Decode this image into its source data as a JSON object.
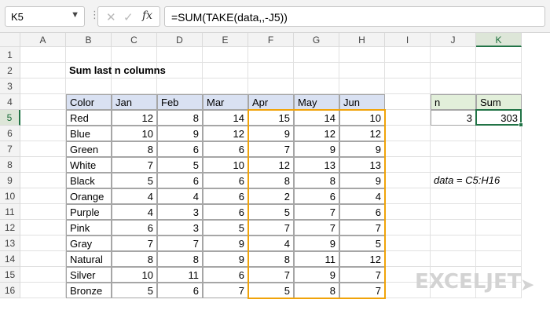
{
  "formula_bar": {
    "name_box": "K5",
    "formula": "=SUM(TAKE(data,,-J5))",
    "fx_label": "fx"
  },
  "columns": [
    "A",
    "B",
    "C",
    "D",
    "E",
    "F",
    "G",
    "H",
    "I",
    "J",
    "K"
  ],
  "rows": [
    "1",
    "2",
    "3",
    "4",
    "5",
    "6",
    "7",
    "8",
    "9",
    "10",
    "11",
    "12",
    "13",
    "14",
    "15",
    "16"
  ],
  "selected_column": "K",
  "selected_row": "5",
  "sheet": {
    "title": "Sum last n columns",
    "headers": [
      "Color",
      "Jan",
      "Feb",
      "Mar",
      "Apr",
      "May",
      "Jun"
    ],
    "data": [
      [
        "Red",
        12,
        8,
        14,
        15,
        14,
        10
      ],
      [
        "Blue",
        10,
        9,
        12,
        9,
        12,
        12
      ],
      [
        "Green",
        8,
        6,
        6,
        7,
        9,
        9
      ],
      [
        "White",
        7,
        5,
        10,
        12,
        13,
        13
      ],
      [
        "Black",
        5,
        6,
        6,
        8,
        8,
        9
      ],
      [
        "Orange",
        4,
        4,
        6,
        2,
        6,
        4
      ],
      [
        "Purple",
        4,
        3,
        6,
        5,
        7,
        6
      ],
      [
        "Pink",
        6,
        3,
        5,
        7,
        7,
        7
      ],
      [
        "Gray",
        7,
        7,
        9,
        4,
        9,
        5
      ],
      [
        "Natural",
        8,
        8,
        9,
        8,
        11,
        12
      ],
      [
        "Silver",
        10,
        11,
        6,
        7,
        9,
        7
      ],
      [
        "Bronze",
        5,
        6,
        7,
        5,
        8,
        7
      ]
    ],
    "input_headers": [
      "n",
      "Sum"
    ],
    "input_values": [
      3,
      303
    ],
    "note": "data = C5:H16"
  },
  "colors": {
    "header_blue": "#d9e1f2",
    "header_green": "#e2efda",
    "selection": "#217346",
    "range_outline": "#f0a30a"
  },
  "logo": {
    "text": "EXCELJET"
  }
}
